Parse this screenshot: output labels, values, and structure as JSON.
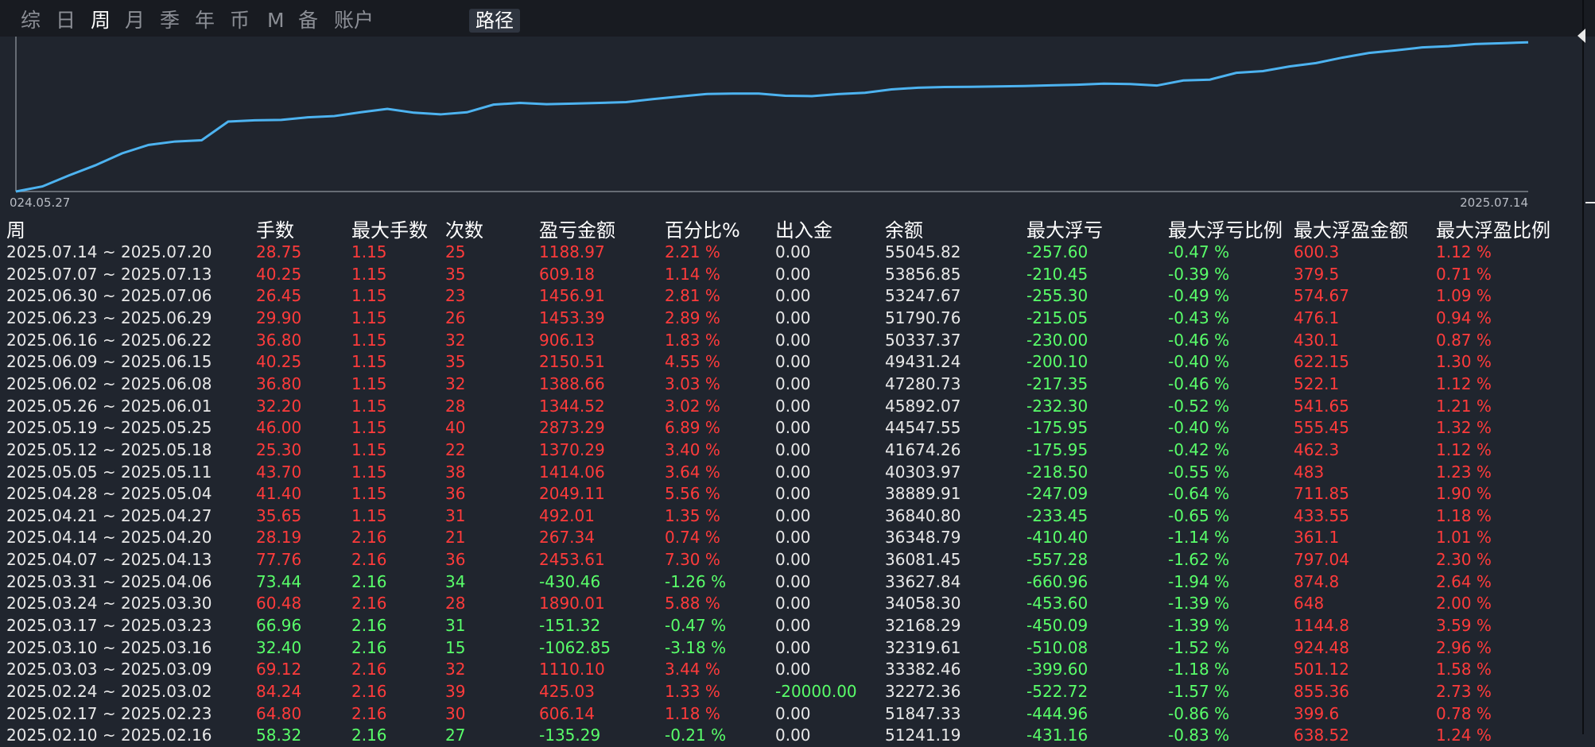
{
  "tabs": [
    {
      "label": "综",
      "active": false
    },
    {
      "label": "日",
      "active": false
    },
    {
      "label": "周",
      "active": true
    },
    {
      "label": "月",
      "active": false
    },
    {
      "label": "季",
      "active": false
    },
    {
      "label": "年",
      "active": false
    },
    {
      "label": "币",
      "active": false
    },
    {
      "label": "M",
      "active": false
    },
    {
      "label": "备",
      "active": false
    },
    {
      "label": "账户",
      "active": false
    }
  ],
  "route_tab": "路径",
  "colors": {
    "positive": "#ff3b3b",
    "negative": "#59ff6a",
    "neutral": "#e8e8e8",
    "line": "#4db3f0"
  },
  "chart_data": {
    "type": "line",
    "x_start_label": "024.05.27",
    "x_end_label": "2025.07.14",
    "series": [
      {
        "values": [
          0,
          120,
          380,
          620,
          900,
          1100,
          1180,
          1210,
          1650,
          1680,
          1690,
          1750,
          1780,
          1870,
          1950,
          1860,
          1820,
          1870,
          2050,
          2090,
          2060,
          2075,
          2090,
          2110,
          2180,
          2240,
          2300,
          2310,
          2310,
          2260,
          2250,
          2300,
          2330,
          2410,
          2450,
          2465,
          2470,
          2480,
          2490,
          2505,
          2520,
          2545,
          2535,
          2500,
          2620,
          2640,
          2800,
          2840,
          2950,
          3030,
          3160,
          3270,
          3330,
          3400,
          3430,
          3480,
          3500,
          3520
        ]
      }
    ],
    "ylim": [
      0,
      3600
    ]
  },
  "headers": [
    "周",
    "手数",
    "最大手数",
    "次数",
    "盈亏金额",
    "百分比%",
    "出入金",
    "余额",
    "最大浮亏",
    "最大浮亏比例",
    "最大浮盈金额",
    "最大浮盈比例"
  ],
  "rows": [
    {
      "week": "2025.07.14 ~ 2025.07.20",
      "lots": "28.75",
      "max_lots": "1.15",
      "count": "25",
      "pnl": "1188.97",
      "pct": "2.21 %",
      "flow": "0.00",
      "balance": "55045.82",
      "max_dd": "-257.60",
      "max_dd_pct": "-0.47 %",
      "max_fp": "600.3",
      "max_fp_pct": "1.12 %",
      "sign": "pos"
    },
    {
      "week": "2025.07.07 ~ 2025.07.13",
      "lots": "40.25",
      "max_lots": "1.15",
      "count": "35",
      "pnl": "609.18",
      "pct": "1.14 %",
      "flow": "0.00",
      "balance": "53856.85",
      "max_dd": "-210.45",
      "max_dd_pct": "-0.39 %",
      "max_fp": "379.5",
      "max_fp_pct": "0.71 %",
      "sign": "pos"
    },
    {
      "week": "2025.06.30 ~ 2025.07.06",
      "lots": "26.45",
      "max_lots": "1.15",
      "count": "23",
      "pnl": "1456.91",
      "pct": "2.81 %",
      "flow": "0.00",
      "balance": "53247.67",
      "max_dd": "-255.30",
      "max_dd_pct": "-0.49 %",
      "max_fp": "574.67",
      "max_fp_pct": "1.09 %",
      "sign": "pos"
    },
    {
      "week": "2025.06.23 ~ 2025.06.29",
      "lots": "29.90",
      "max_lots": "1.15",
      "count": "26",
      "pnl": "1453.39",
      "pct": "2.89 %",
      "flow": "0.00",
      "balance": "51790.76",
      "max_dd": "-215.05",
      "max_dd_pct": "-0.43 %",
      "max_fp": "476.1",
      "max_fp_pct": "0.94 %",
      "sign": "pos"
    },
    {
      "week": "2025.06.16 ~ 2025.06.22",
      "lots": "36.80",
      "max_lots": "1.15",
      "count": "32",
      "pnl": "906.13",
      "pct": "1.83 %",
      "flow": "0.00",
      "balance": "50337.37",
      "max_dd": "-230.00",
      "max_dd_pct": "-0.46 %",
      "max_fp": "430.1",
      "max_fp_pct": "0.87 %",
      "sign": "pos"
    },
    {
      "week": "2025.06.09 ~ 2025.06.15",
      "lots": "40.25",
      "max_lots": "1.15",
      "count": "35",
      "pnl": "2150.51",
      "pct": "4.55 %",
      "flow": "0.00",
      "balance": "49431.24",
      "max_dd": "-200.10",
      "max_dd_pct": "-0.40 %",
      "max_fp": "622.15",
      "max_fp_pct": "1.30 %",
      "sign": "pos"
    },
    {
      "week": "2025.06.02 ~ 2025.06.08",
      "lots": "36.80",
      "max_lots": "1.15",
      "count": "32",
      "pnl": "1388.66",
      "pct": "3.03 %",
      "flow": "0.00",
      "balance": "47280.73",
      "max_dd": "-217.35",
      "max_dd_pct": "-0.46 %",
      "max_fp": "522.1",
      "max_fp_pct": "1.12 %",
      "sign": "pos"
    },
    {
      "week": "2025.05.26 ~ 2025.06.01",
      "lots": "32.20",
      "max_lots": "1.15",
      "count": "28",
      "pnl": "1344.52",
      "pct": "3.02 %",
      "flow": "0.00",
      "balance": "45892.07",
      "max_dd": "-232.30",
      "max_dd_pct": "-0.52 %",
      "max_fp": "541.65",
      "max_fp_pct": "1.21 %",
      "sign": "pos"
    },
    {
      "week": "2025.05.19 ~ 2025.05.25",
      "lots": "46.00",
      "max_lots": "1.15",
      "count": "40",
      "pnl": "2873.29",
      "pct": "6.89 %",
      "flow": "0.00",
      "balance": "44547.55",
      "max_dd": "-175.95",
      "max_dd_pct": "-0.40 %",
      "max_fp": "555.45",
      "max_fp_pct": "1.32 %",
      "sign": "pos"
    },
    {
      "week": "2025.05.12 ~ 2025.05.18",
      "lots": "25.30",
      "max_lots": "1.15",
      "count": "22",
      "pnl": "1370.29",
      "pct": "3.40 %",
      "flow": "0.00",
      "balance": "41674.26",
      "max_dd": "-175.95",
      "max_dd_pct": "-0.42 %",
      "max_fp": "462.3",
      "max_fp_pct": "1.12 %",
      "sign": "pos"
    },
    {
      "week": "2025.05.05 ~ 2025.05.11",
      "lots": "43.70",
      "max_lots": "1.15",
      "count": "38",
      "pnl": "1414.06",
      "pct": "3.64 %",
      "flow": "0.00",
      "balance": "40303.97",
      "max_dd": "-218.50",
      "max_dd_pct": "-0.55 %",
      "max_fp": "483",
      "max_fp_pct": "1.23 %",
      "sign": "pos"
    },
    {
      "week": "2025.04.28 ~ 2025.05.04",
      "lots": "41.40",
      "max_lots": "1.15",
      "count": "36",
      "pnl": "2049.11",
      "pct": "5.56 %",
      "flow": "0.00",
      "balance": "38889.91",
      "max_dd": "-247.09",
      "max_dd_pct": "-0.64 %",
      "max_fp": "711.85",
      "max_fp_pct": "1.90 %",
      "sign": "pos"
    },
    {
      "week": "2025.04.21 ~ 2025.04.27",
      "lots": "35.65",
      "max_lots": "1.15",
      "count": "31",
      "pnl": "492.01",
      "pct": "1.35 %",
      "flow": "0.00",
      "balance": "36840.80",
      "max_dd": "-233.45",
      "max_dd_pct": "-0.65 %",
      "max_fp": "433.55",
      "max_fp_pct": "1.18 %",
      "sign": "pos"
    },
    {
      "week": "2025.04.14 ~ 2025.04.20",
      "lots": "28.19",
      "max_lots": "2.16",
      "count": "21",
      "pnl": "267.34",
      "pct": "0.74 %",
      "flow": "0.00",
      "balance": "36348.79",
      "max_dd": "-410.40",
      "max_dd_pct": "-1.14 %",
      "max_fp": "361.1",
      "max_fp_pct": "1.01 %",
      "sign": "pos"
    },
    {
      "week": "2025.04.07 ~ 2025.04.13",
      "lots": "77.76",
      "max_lots": "2.16",
      "count": "36",
      "pnl": "2453.61",
      "pct": "7.30 %",
      "flow": "0.00",
      "balance": "36081.45",
      "max_dd": "-557.28",
      "max_dd_pct": "-1.62 %",
      "max_fp": "797.04",
      "max_fp_pct": "2.30 %",
      "sign": "pos"
    },
    {
      "week": "2025.03.31 ~ 2025.04.06",
      "lots": "73.44",
      "max_lots": "2.16",
      "count": "34",
      "pnl": "-430.46",
      "pct": "-1.26 %",
      "flow": "0.00",
      "balance": "33627.84",
      "max_dd": "-660.96",
      "max_dd_pct": "-1.94 %",
      "max_fp": "874.8",
      "max_fp_pct": "2.64 %",
      "sign": "neg"
    },
    {
      "week": "2025.03.24 ~ 2025.03.30",
      "lots": "60.48",
      "max_lots": "2.16",
      "count": "28",
      "pnl": "1890.01",
      "pct": "5.88 %",
      "flow": "0.00",
      "balance": "34058.30",
      "max_dd": "-453.60",
      "max_dd_pct": "-1.39 %",
      "max_fp": "648",
      "max_fp_pct": "2.00 %",
      "sign": "pos"
    },
    {
      "week": "2025.03.17 ~ 2025.03.23",
      "lots": "66.96",
      "max_lots": "2.16",
      "count": "31",
      "pnl": "-151.32",
      "pct": "-0.47 %",
      "flow": "0.00",
      "balance": "32168.29",
      "max_dd": "-450.09",
      "max_dd_pct": "-1.39 %",
      "max_fp": "1144.8",
      "max_fp_pct": "3.59 %",
      "sign": "neg"
    },
    {
      "week": "2025.03.10 ~ 2025.03.16",
      "lots": "32.40",
      "max_lots": "2.16",
      "count": "15",
      "pnl": "-1062.85",
      "pct": "-3.18 %",
      "flow": "0.00",
      "balance": "32319.61",
      "max_dd": "-510.08",
      "max_dd_pct": "-1.52 %",
      "max_fp": "924.48",
      "max_fp_pct": "2.96 %",
      "sign": "neg"
    },
    {
      "week": "2025.03.03 ~ 2025.03.09",
      "lots": "69.12",
      "max_lots": "2.16",
      "count": "32",
      "pnl": "1110.10",
      "pct": "3.44 %",
      "flow": "0.00",
      "balance": "33382.46",
      "max_dd": "-399.60",
      "max_dd_pct": "-1.18 %",
      "max_fp": "501.12",
      "max_fp_pct": "1.58 %",
      "sign": "pos"
    },
    {
      "week": "2025.02.24 ~ 2025.03.02",
      "lots": "84.24",
      "max_lots": "2.16",
      "count": "39",
      "pnl": "425.03",
      "pct": "1.33 %",
      "flow": "-20000.00",
      "balance": "32272.36",
      "max_dd": "-522.72",
      "max_dd_pct": "-1.57 %",
      "max_fp": "855.36",
      "max_fp_pct": "2.73 %",
      "sign": "pos",
      "flow_color": "neg"
    },
    {
      "week": "2025.02.17 ~ 2025.02.23",
      "lots": "64.80",
      "max_lots": "2.16",
      "count": "30",
      "pnl": "606.14",
      "pct": "1.18 %",
      "flow": "0.00",
      "balance": "51847.33",
      "max_dd": "-444.96",
      "max_dd_pct": "-0.86 %",
      "max_fp": "399.6",
      "max_fp_pct": "0.78 %",
      "sign": "pos"
    },
    {
      "week": "2025.02.10 ~ 2025.02.16",
      "lots": "58.32",
      "max_lots": "2.16",
      "count": "27",
      "pnl": "-135.29",
      "pct": "-0.21 %",
      "flow": "0.00",
      "balance": "51241.19",
      "max_dd": "-431.16",
      "max_dd_pct": "-0.83 %",
      "max_fp": "638.52",
      "max_fp_pct": "1.24 %",
      "sign": "neg"
    }
  ]
}
